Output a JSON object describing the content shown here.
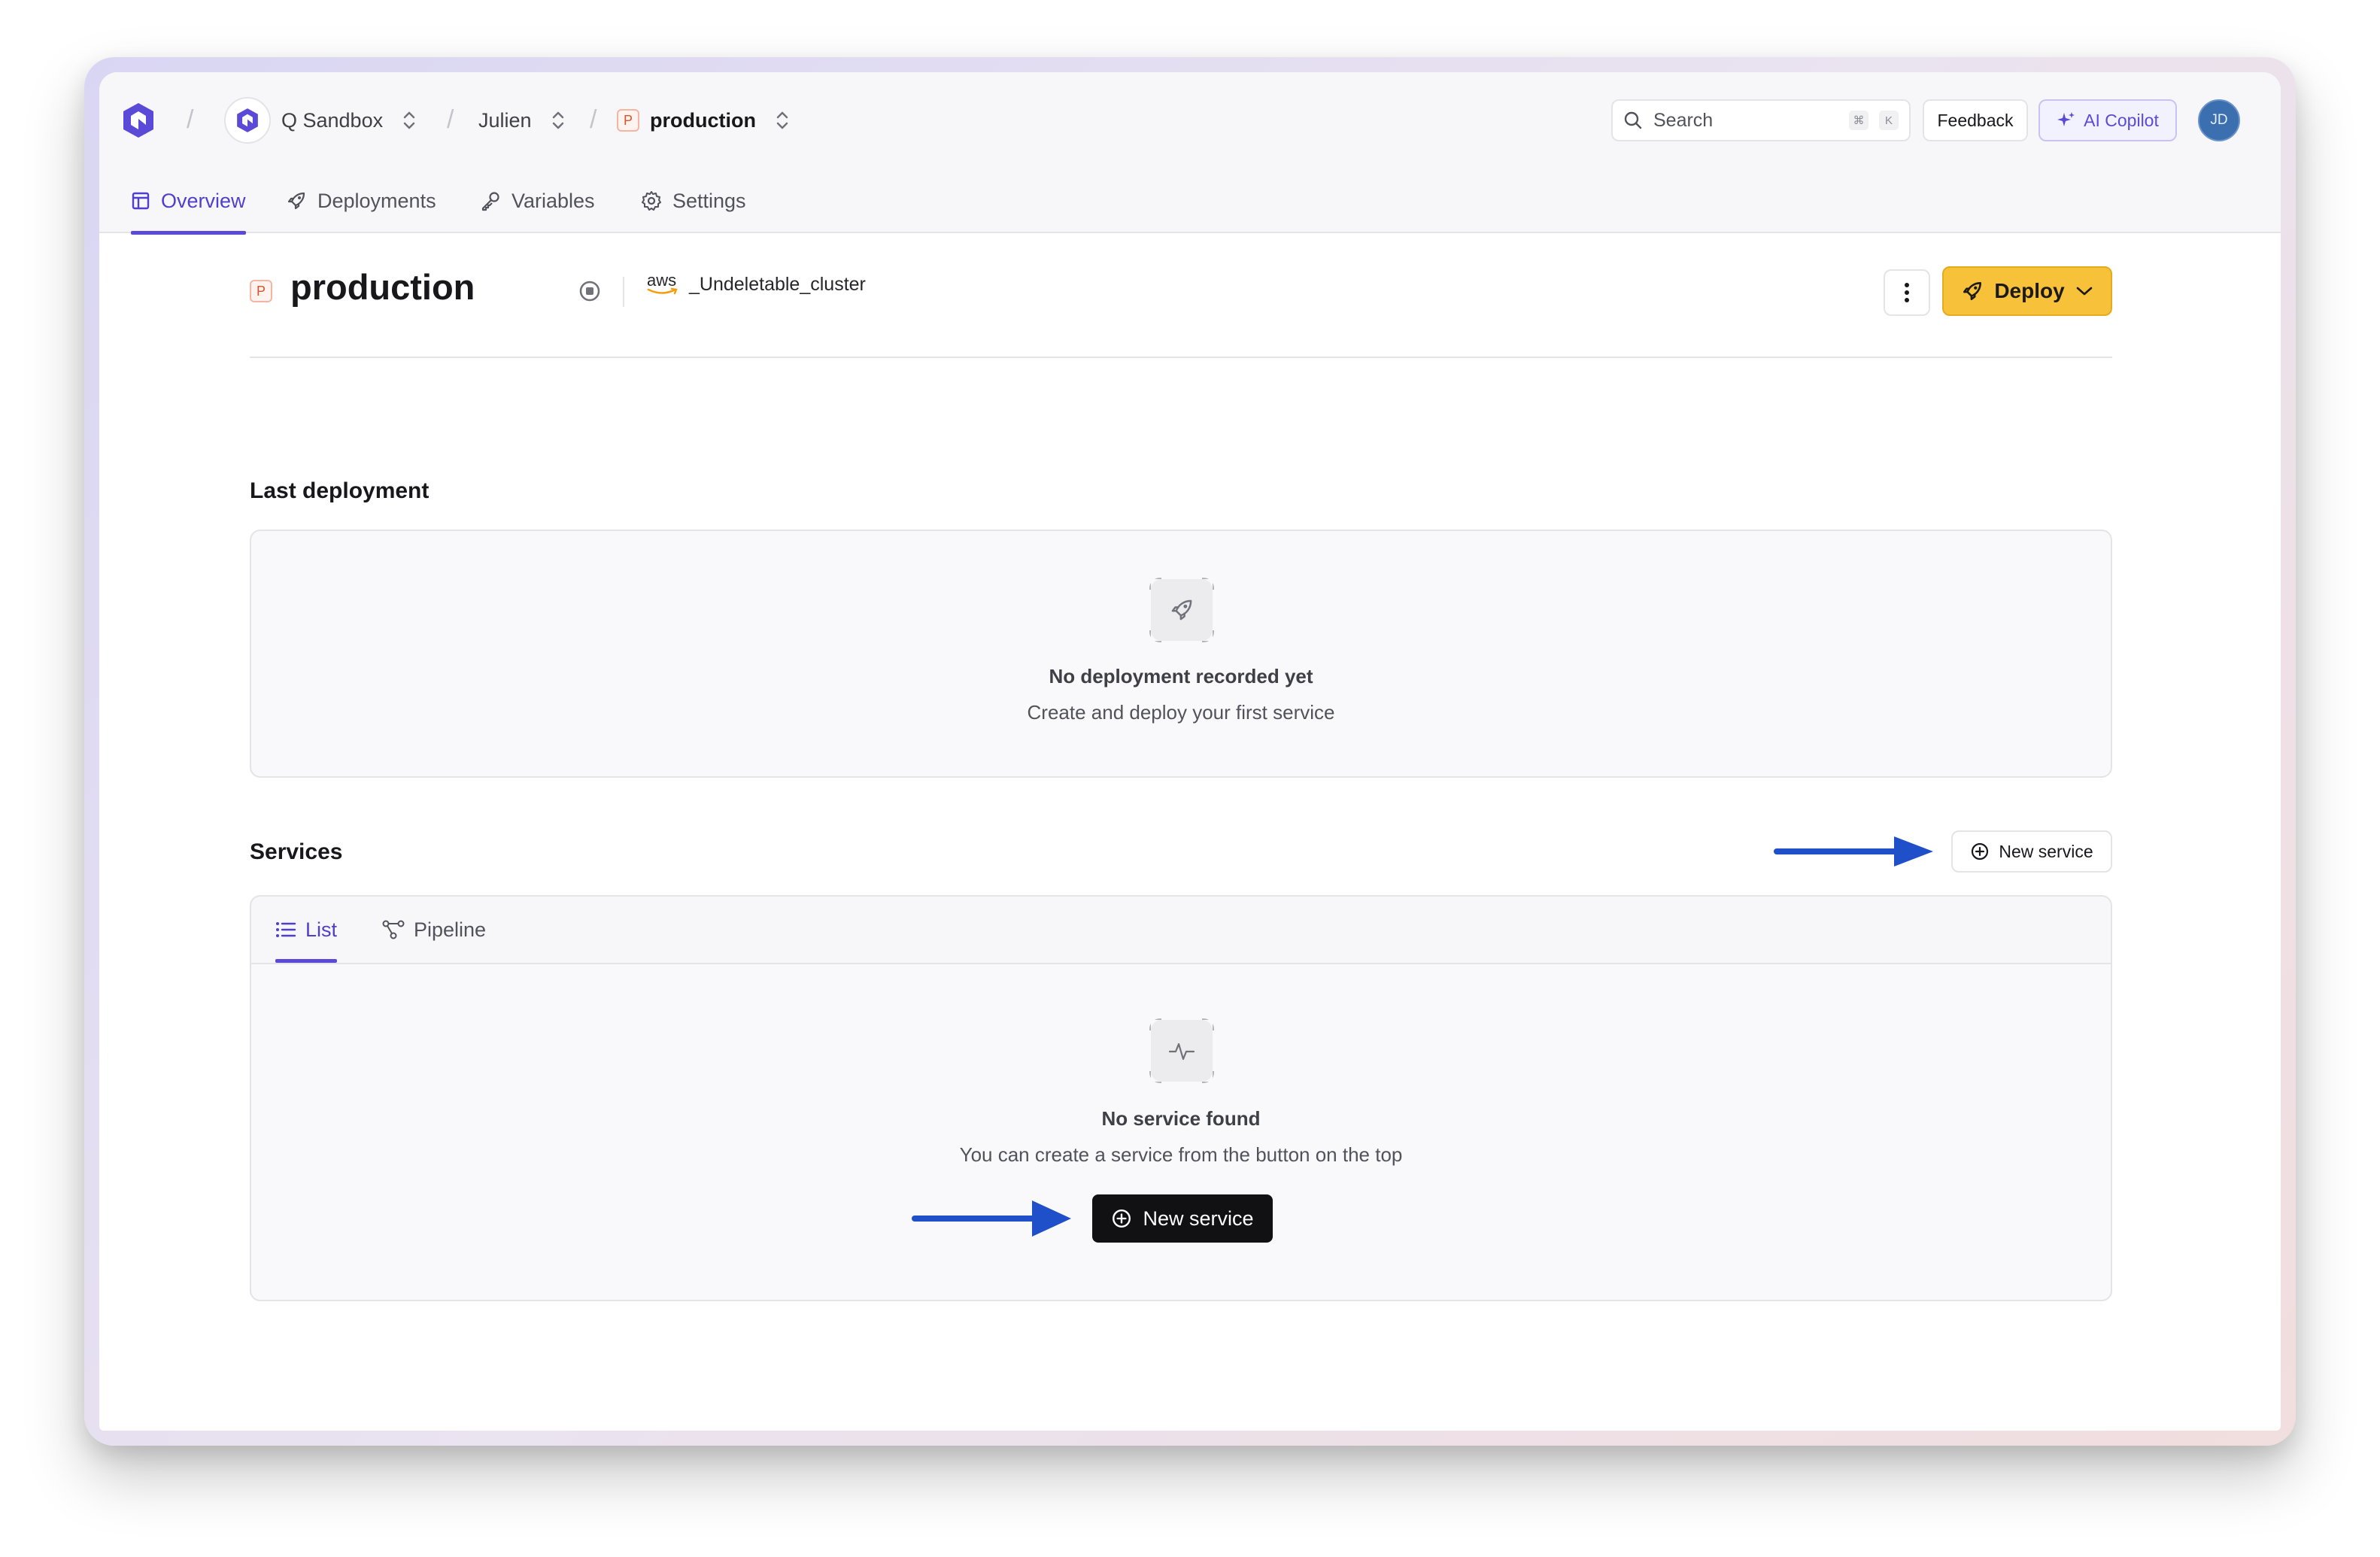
{
  "breadcrumb": {
    "organization": "Q Sandbox",
    "project": "Julien",
    "environment": "production",
    "environment_badge": "P"
  },
  "search": {
    "placeholder": "Search",
    "shortcut_mod": "⌘",
    "shortcut_key": "K"
  },
  "header_actions": {
    "feedback_label": "Feedback",
    "copilot_label": "AI Copilot",
    "user_initials": "JD"
  },
  "tabs": [
    {
      "label": "Overview",
      "icon": "layout-icon",
      "active": true
    },
    {
      "label": "Deployments",
      "icon": "rocket-icon",
      "active": false
    },
    {
      "label": "Variables",
      "icon": "key-icon",
      "active": false
    },
    {
      "label": "Settings",
      "icon": "gear-icon",
      "active": false
    }
  ],
  "page": {
    "badge": "P",
    "title": "production",
    "cluster_provider": "aws",
    "cluster_name": "_Undeletable_cluster",
    "deploy_label": "Deploy"
  },
  "last_deployment": {
    "title": "Last deployment",
    "empty_title": "No deployment recorded yet",
    "empty_subtitle": "Create and deploy your first service"
  },
  "services": {
    "title": "Services",
    "new_service_label": "New service",
    "tabs": [
      {
        "label": "List",
        "active": true
      },
      {
        "label": "Pipeline",
        "active": false
      }
    ],
    "empty_title": "No service found",
    "empty_subtitle": "You can create a service from the button on the top",
    "empty_button_label": "New service"
  },
  "colors": {
    "accent": "#5b4ad8",
    "deploy": "#f7c23a",
    "arrow": "#1f4fc9",
    "badge": "#d9532c"
  }
}
